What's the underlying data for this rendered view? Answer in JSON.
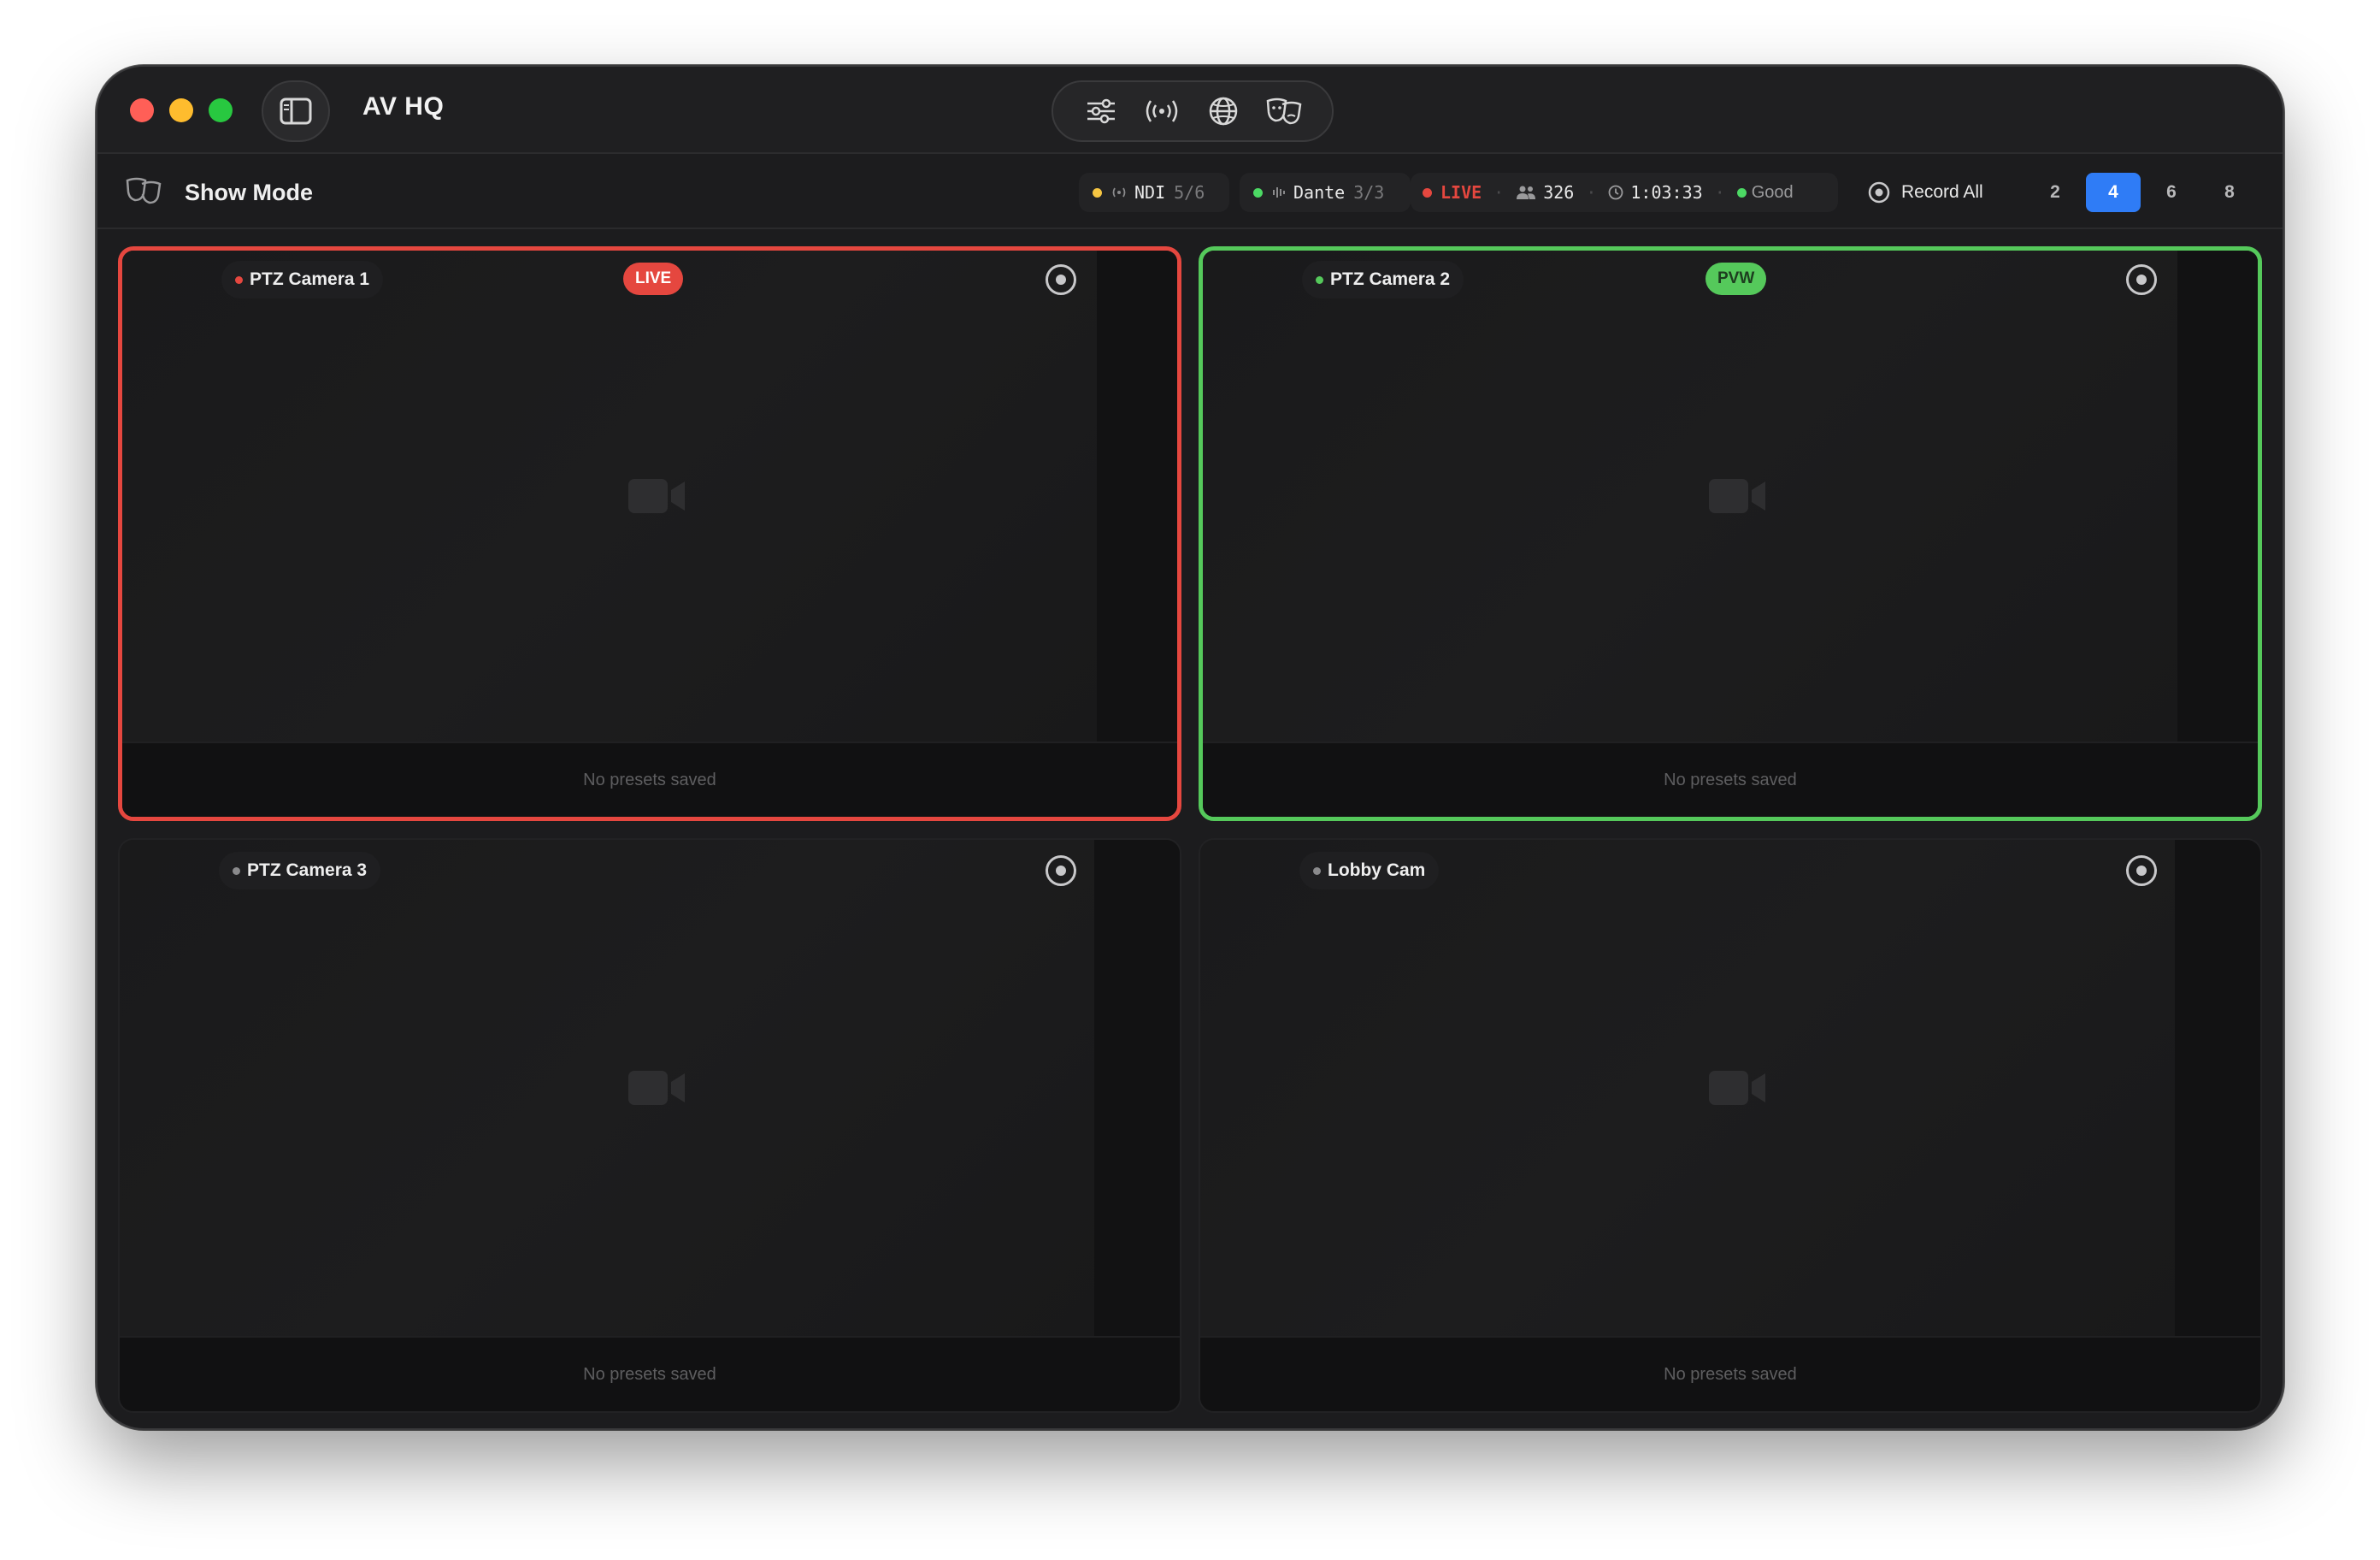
{
  "window": {
    "title": "AV HQ"
  },
  "toolbar": {
    "mode_label": "Show Mode",
    "ndi": {
      "label": "NDI",
      "count": "5/6",
      "color": "#f5c542"
    },
    "dante": {
      "label": "Dante",
      "count": "3/3",
      "color": "#4cd964"
    },
    "live_label": "LIVE",
    "viewers": "326",
    "elapsed": "1:03:33",
    "health": "Good",
    "record_all_label": "Record All",
    "grid_options": [
      "2",
      "4",
      "6",
      "8"
    ],
    "grid_selected": "4"
  },
  "tiles": [
    {
      "name": "PTZ Camera 1",
      "tag": "LIVE",
      "presets_text": "No presets saved",
      "status_color": "#e5473f"
    },
    {
      "name": "PTZ Camera 2",
      "tag": "PVW",
      "presets_text": "No presets saved",
      "status_color": "#55c95b"
    },
    {
      "name": "PTZ Camera 3",
      "tag": "",
      "presets_text": "No presets saved",
      "status_color": "#8a8a8c"
    },
    {
      "name": "Lobby Cam",
      "tag": "",
      "presets_text": "No presets saved",
      "status_color": "#8a8a8c"
    }
  ],
  "colors": {
    "live": "#e5473f",
    "preview": "#55c95b",
    "accent": "#2f7cf6"
  },
  "icons": {
    "title_center": [
      "sliders-icon",
      "broadcast-icon",
      "globe-icon",
      "theater-masks-icon"
    ],
    "tile_placeholder": "video-camera-icon",
    "tile_action": "record-icon"
  }
}
